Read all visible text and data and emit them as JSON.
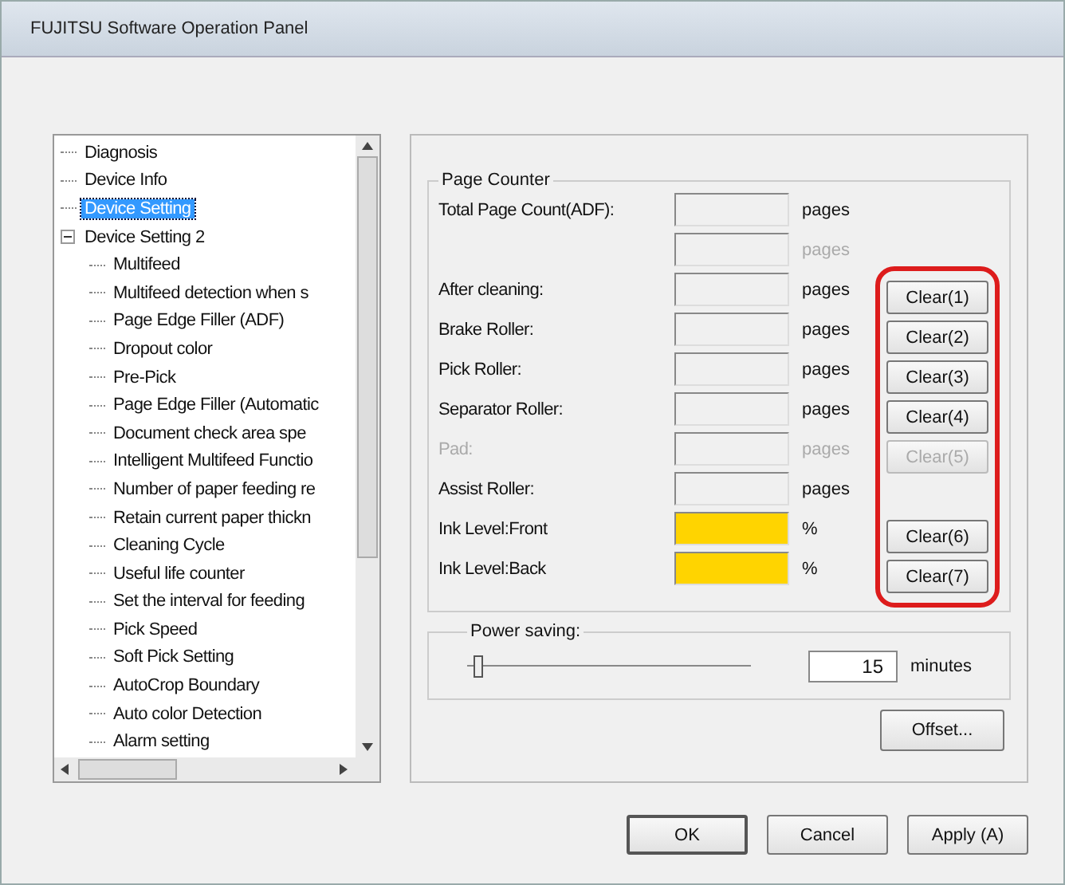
{
  "window": {
    "title": "FUJITSU Software Operation Panel"
  },
  "tree": {
    "items": [
      {
        "label": "Diagnosis",
        "selected": false
      },
      {
        "label": "Device Info",
        "selected": false
      },
      {
        "label": "Device Setting",
        "selected": true
      },
      {
        "label": "Device Setting 2",
        "selected": false,
        "expanded": true,
        "children": [
          {
            "label": "Multifeed",
            "selected": false
          },
          {
            "label": "Multifeed detection when s",
            "selected": false
          },
          {
            "label": "Page Edge Filler (ADF)",
            "selected": false
          },
          {
            "label": "Dropout color",
            "selected": false
          },
          {
            "label": "Pre-Pick",
            "selected": false
          },
          {
            "label": "Page Edge Filler (Automatic",
            "selected": false
          },
          {
            "label": "Document check area spe",
            "selected": false
          },
          {
            "label": "Intelligent Multifeed Functio",
            "selected": false
          },
          {
            "label": "Number of paper feeding re",
            "selected": false
          },
          {
            "label": "Retain current paper thickn",
            "selected": false
          },
          {
            "label": "Cleaning Cycle",
            "selected": false
          },
          {
            "label": "Useful life counter",
            "selected": false
          },
          {
            "label": "Set the interval for feeding",
            "selected": false
          },
          {
            "label": "Pick Speed",
            "selected": false
          },
          {
            "label": "Soft Pick Setting",
            "selected": false
          },
          {
            "label": "AutoCrop Boundary",
            "selected": false
          },
          {
            "label": "Auto color Detection",
            "selected": false
          },
          {
            "label": "Alarm setting",
            "selected": false
          }
        ]
      }
    ]
  },
  "page_counter": {
    "title": "Page Counter",
    "rows": [
      {
        "kind": "counter",
        "label": "Total Page Count(ADF):",
        "unit": "pages",
        "disabled": false
      },
      {
        "kind": "counter",
        "unit": "pages",
        "disabled": true
      },
      {
        "kind": "counter",
        "label": "After cleaning:",
        "unit": "pages",
        "disabled": false,
        "button": "Clear(1)"
      },
      {
        "kind": "counter",
        "label": "Brake Roller:",
        "unit": "pages",
        "disabled": false,
        "button": "Clear(2)"
      },
      {
        "kind": "counter",
        "label": "Pick Roller:",
        "unit": "pages",
        "disabled": false,
        "button": "Clear(3)"
      },
      {
        "kind": "counter",
        "label": "Separator Roller:",
        "unit": "pages",
        "disabled": false,
        "button": "Clear(4)"
      },
      {
        "kind": "counter",
        "label": "Pad:",
        "unit": "pages",
        "disabled": true,
        "button": "Clear(5)"
      },
      {
        "kind": "counter",
        "label": "Assist Roller:",
        "unit": "pages",
        "disabled": false
      },
      {
        "kind": "ink",
        "label": "Ink Level:Front",
        "unit": "%",
        "disabled": false,
        "button": "Clear(6)"
      },
      {
        "kind": "ink",
        "label": "Ink Level:Back",
        "unit": "%",
        "disabled": false,
        "button": "Clear(7)"
      }
    ]
  },
  "power_saving": {
    "title": "Power saving:",
    "level": 0.02,
    "value": "15",
    "unit": "minutes"
  },
  "offset_button": "Offset...",
  "buttons": [
    "OK",
    "Cancel",
    "Apply (A)"
  ]
}
